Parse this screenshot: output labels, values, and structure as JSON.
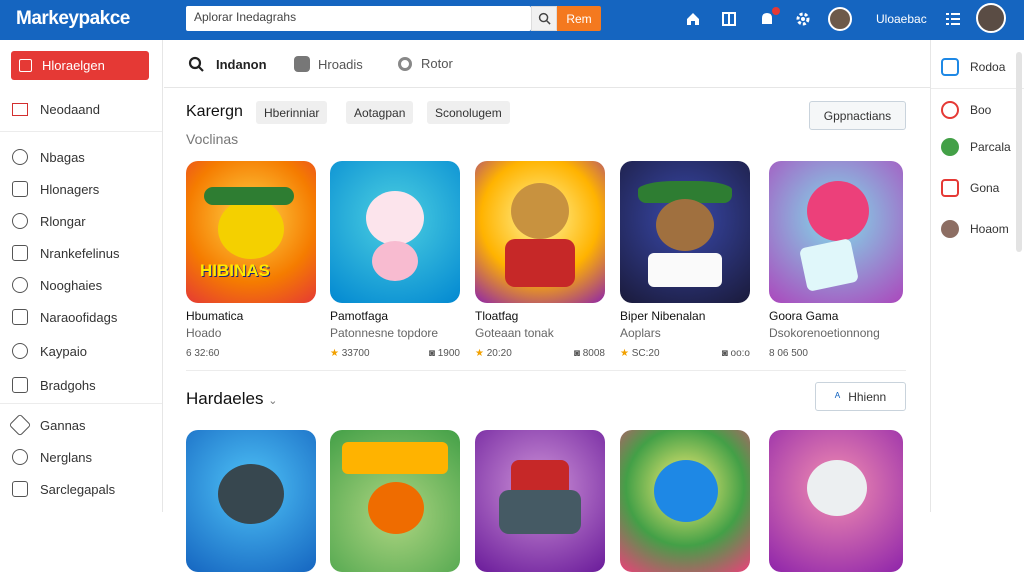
{
  "header": {
    "logo": "Markeypakce",
    "search_placeholder": "Aplorar Inedagrahs",
    "go_label": "Rem",
    "user_name": "Uloaebac"
  },
  "sidebar": {
    "active": "Hloraelgen",
    "items": [
      "Neodaand",
      "Nbagas",
      "Hlonagers",
      "Rlongar",
      "Nrankefelinus",
      "Nooghaies",
      "Naraoofidags",
      "Kaypaio",
      "Bradgohs",
      "Gannas",
      "Nerglans",
      "Sarclegapals"
    ]
  },
  "tabs": [
    "Indanon",
    "Hroadis",
    "Rotor"
  ],
  "filters": {
    "label": "Karergn",
    "chips": [
      "Hberinniar",
      "Aotagpan",
      "Sconolugem"
    ],
    "right_button": "Gppnactians",
    "subtitle": "Voclinas"
  },
  "section1": {
    "cards": [
      {
        "title": "Hbumatica",
        "sub": "Hoado",
        "rating": "6 32:60",
        "meta": ""
      },
      {
        "title": "Pamotfaga",
        "sub": "Patonnesne topdore",
        "rating": "33700",
        "meta": "1900"
      },
      {
        "title": "Tloatfag",
        "sub": "Goteaan tonak",
        "rating": "20:20",
        "meta": "8008"
      },
      {
        "title": "Biper Nibenalan",
        "sub": "Aoplars",
        "rating": "SC:20",
        "meta": "oo:o"
      },
      {
        "title": "Goora Gama",
        "sub": "Dsokorenoetionnong",
        "rating": "8 06 500",
        "meta": ""
      }
    ]
  },
  "section2": {
    "title": "Hardaeles",
    "button": "Hhienn"
  },
  "right_sidebar": [
    "Rodoa",
    "Boo",
    "Parcala",
    "Gona",
    "Hoaom"
  ],
  "colors": {
    "topbar": "#1565c0",
    "accent": "#e53935",
    "go": "#f4791f"
  }
}
